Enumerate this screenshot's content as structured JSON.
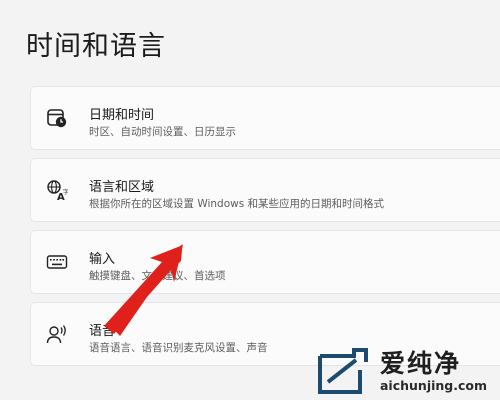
{
  "page": {
    "title": "时间和语言"
  },
  "items": [
    {
      "title": "日期和时间",
      "subtitle": "时区、自动时间设置、日历显示",
      "icon": "calendar-clock-icon"
    },
    {
      "title": "语言和区域",
      "subtitle": "根据你所在的区域设置 Windows 和某些应用的日期和时间格式",
      "icon": "language-icon"
    },
    {
      "title": "输入",
      "subtitle": "触摸键盘、文本建议、首选项",
      "icon": "keyboard-icon"
    },
    {
      "title": "语音",
      "subtitle": "语音语言、语音识别麦克风设置、声音",
      "icon": "speech-icon"
    }
  ],
  "annotation": {
    "arrow_color": "#e0201b"
  },
  "watermark": {
    "name": "爱纯净",
    "url": "aichunjing.com"
  }
}
